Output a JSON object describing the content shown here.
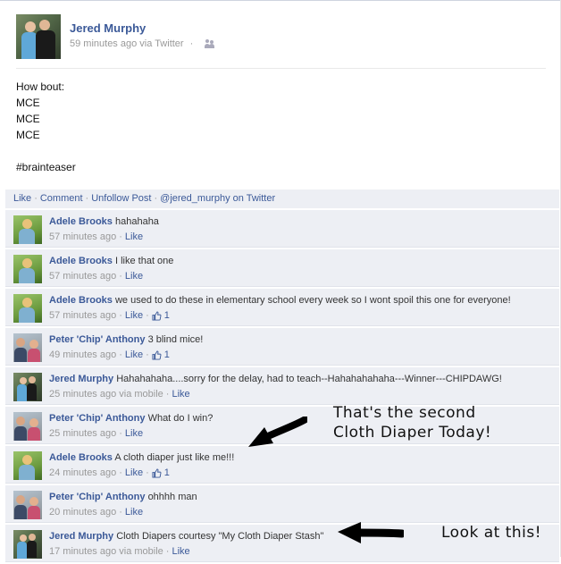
{
  "post": {
    "author": "Jered Murphy",
    "time": "59 minutes ago via Twitter",
    "body_lines": [
      "How bout:",
      "MCE",
      "MCE",
      "MCE",
      "",
      "#brainteaser"
    ]
  },
  "actions": {
    "like": "Like",
    "comment": "Comment",
    "unfollow": "Unfollow Post",
    "twitter": "@jered_murphy on Twitter"
  },
  "comments": [
    {
      "author": "Adele Brooks",
      "text": "hahahaha",
      "time": "57 minutes ago",
      "like": "Like",
      "likes": ""
    },
    {
      "author": "Adele Brooks",
      "text": "I like that one",
      "time": "57 minutes ago",
      "like": "Like",
      "likes": ""
    },
    {
      "author": "Adele Brooks",
      "text": "we used to do these in elementary school every week so I wont spoil this one for everyone!",
      "time": "57 minutes ago",
      "like": "Like",
      "likes": "1"
    },
    {
      "author": "Peter 'Chip' Anthony",
      "text": "3 blind mice!",
      "time": "49 minutes ago",
      "like": "Like",
      "likes": "1"
    },
    {
      "author": "Jered Murphy",
      "text": "Hahahahaha....sorry for the delay, had to teach--Hahahahahaha---Winner---CHIPDAWG!",
      "time": "25 minutes ago via mobile",
      "like": "Like",
      "likes": ""
    },
    {
      "author": "Peter 'Chip' Anthony",
      "text": "What do I win?",
      "time": "25 minutes ago",
      "like": "Like",
      "likes": ""
    },
    {
      "author": "Adele Brooks",
      "text": "A cloth diaper just like me!!!",
      "time": "24 minutes ago",
      "like": "Like",
      "likes": "1"
    },
    {
      "author": "Peter 'Chip' Anthony",
      "text": "ohhhh man",
      "time": "20 minutes ago",
      "like": "Like",
      "likes": ""
    },
    {
      "author": "Jered Murphy",
      "text": "Cloth Diapers courtesy \"My Cloth Diaper Stash\"",
      "time": "17 minutes ago via mobile",
      "like": "Like",
      "likes": ""
    }
  ],
  "annotations": {
    "second_line1": "That's the second",
    "second_line2": "Cloth Diaper Today!",
    "look": "Look at this!"
  },
  "colors": {
    "link": "#3b5998",
    "comment_bg": "#edeff4",
    "meta": "#999999"
  }
}
